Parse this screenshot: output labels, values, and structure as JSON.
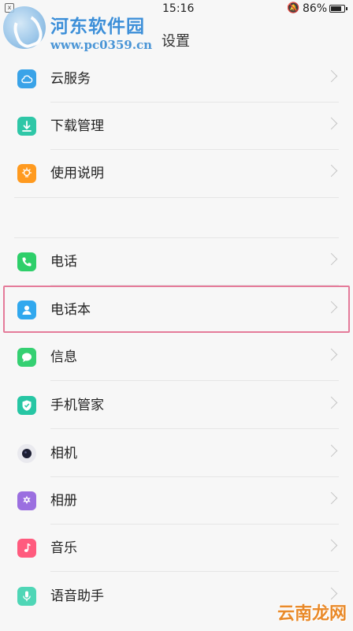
{
  "status_bar": {
    "time": "15:16",
    "battery": "86%",
    "battery_level": 0.86
  },
  "watermark": {
    "title": "河东软件园",
    "url": "www.pc0359.cn"
  },
  "page": {
    "title": "设置"
  },
  "items": [
    {
      "label": "云服务",
      "icon": "cloud-icon",
      "color": "#3aa3e8"
    },
    {
      "label": "下载管理",
      "icon": "download-icon",
      "color": "#2fc7a7"
    },
    {
      "label": "使用说明",
      "icon": "bulb-icon",
      "color": "#ff9a1f"
    },
    {
      "label": "电话",
      "icon": "phone-icon",
      "color": "#2ecf6a"
    },
    {
      "label": "电话本",
      "icon": "contact-icon",
      "color": "#31a8ee"
    },
    {
      "label": "信息",
      "icon": "message-icon",
      "color": "#35d072"
    },
    {
      "label": "手机管家",
      "icon": "shield-icon",
      "color": "#27c6a4"
    },
    {
      "label": "相机",
      "icon": "camera-icon",
      "color": "#e9e9ee"
    },
    {
      "label": "相册",
      "icon": "album-icon",
      "color": "#9b6fe0"
    },
    {
      "label": "音乐",
      "icon": "music-icon",
      "color": "#ff5b7e"
    },
    {
      "label": "语音助手",
      "icon": "mic-icon",
      "color": "#4fd6b6"
    }
  ],
  "corner_watermark": "云南龙网"
}
